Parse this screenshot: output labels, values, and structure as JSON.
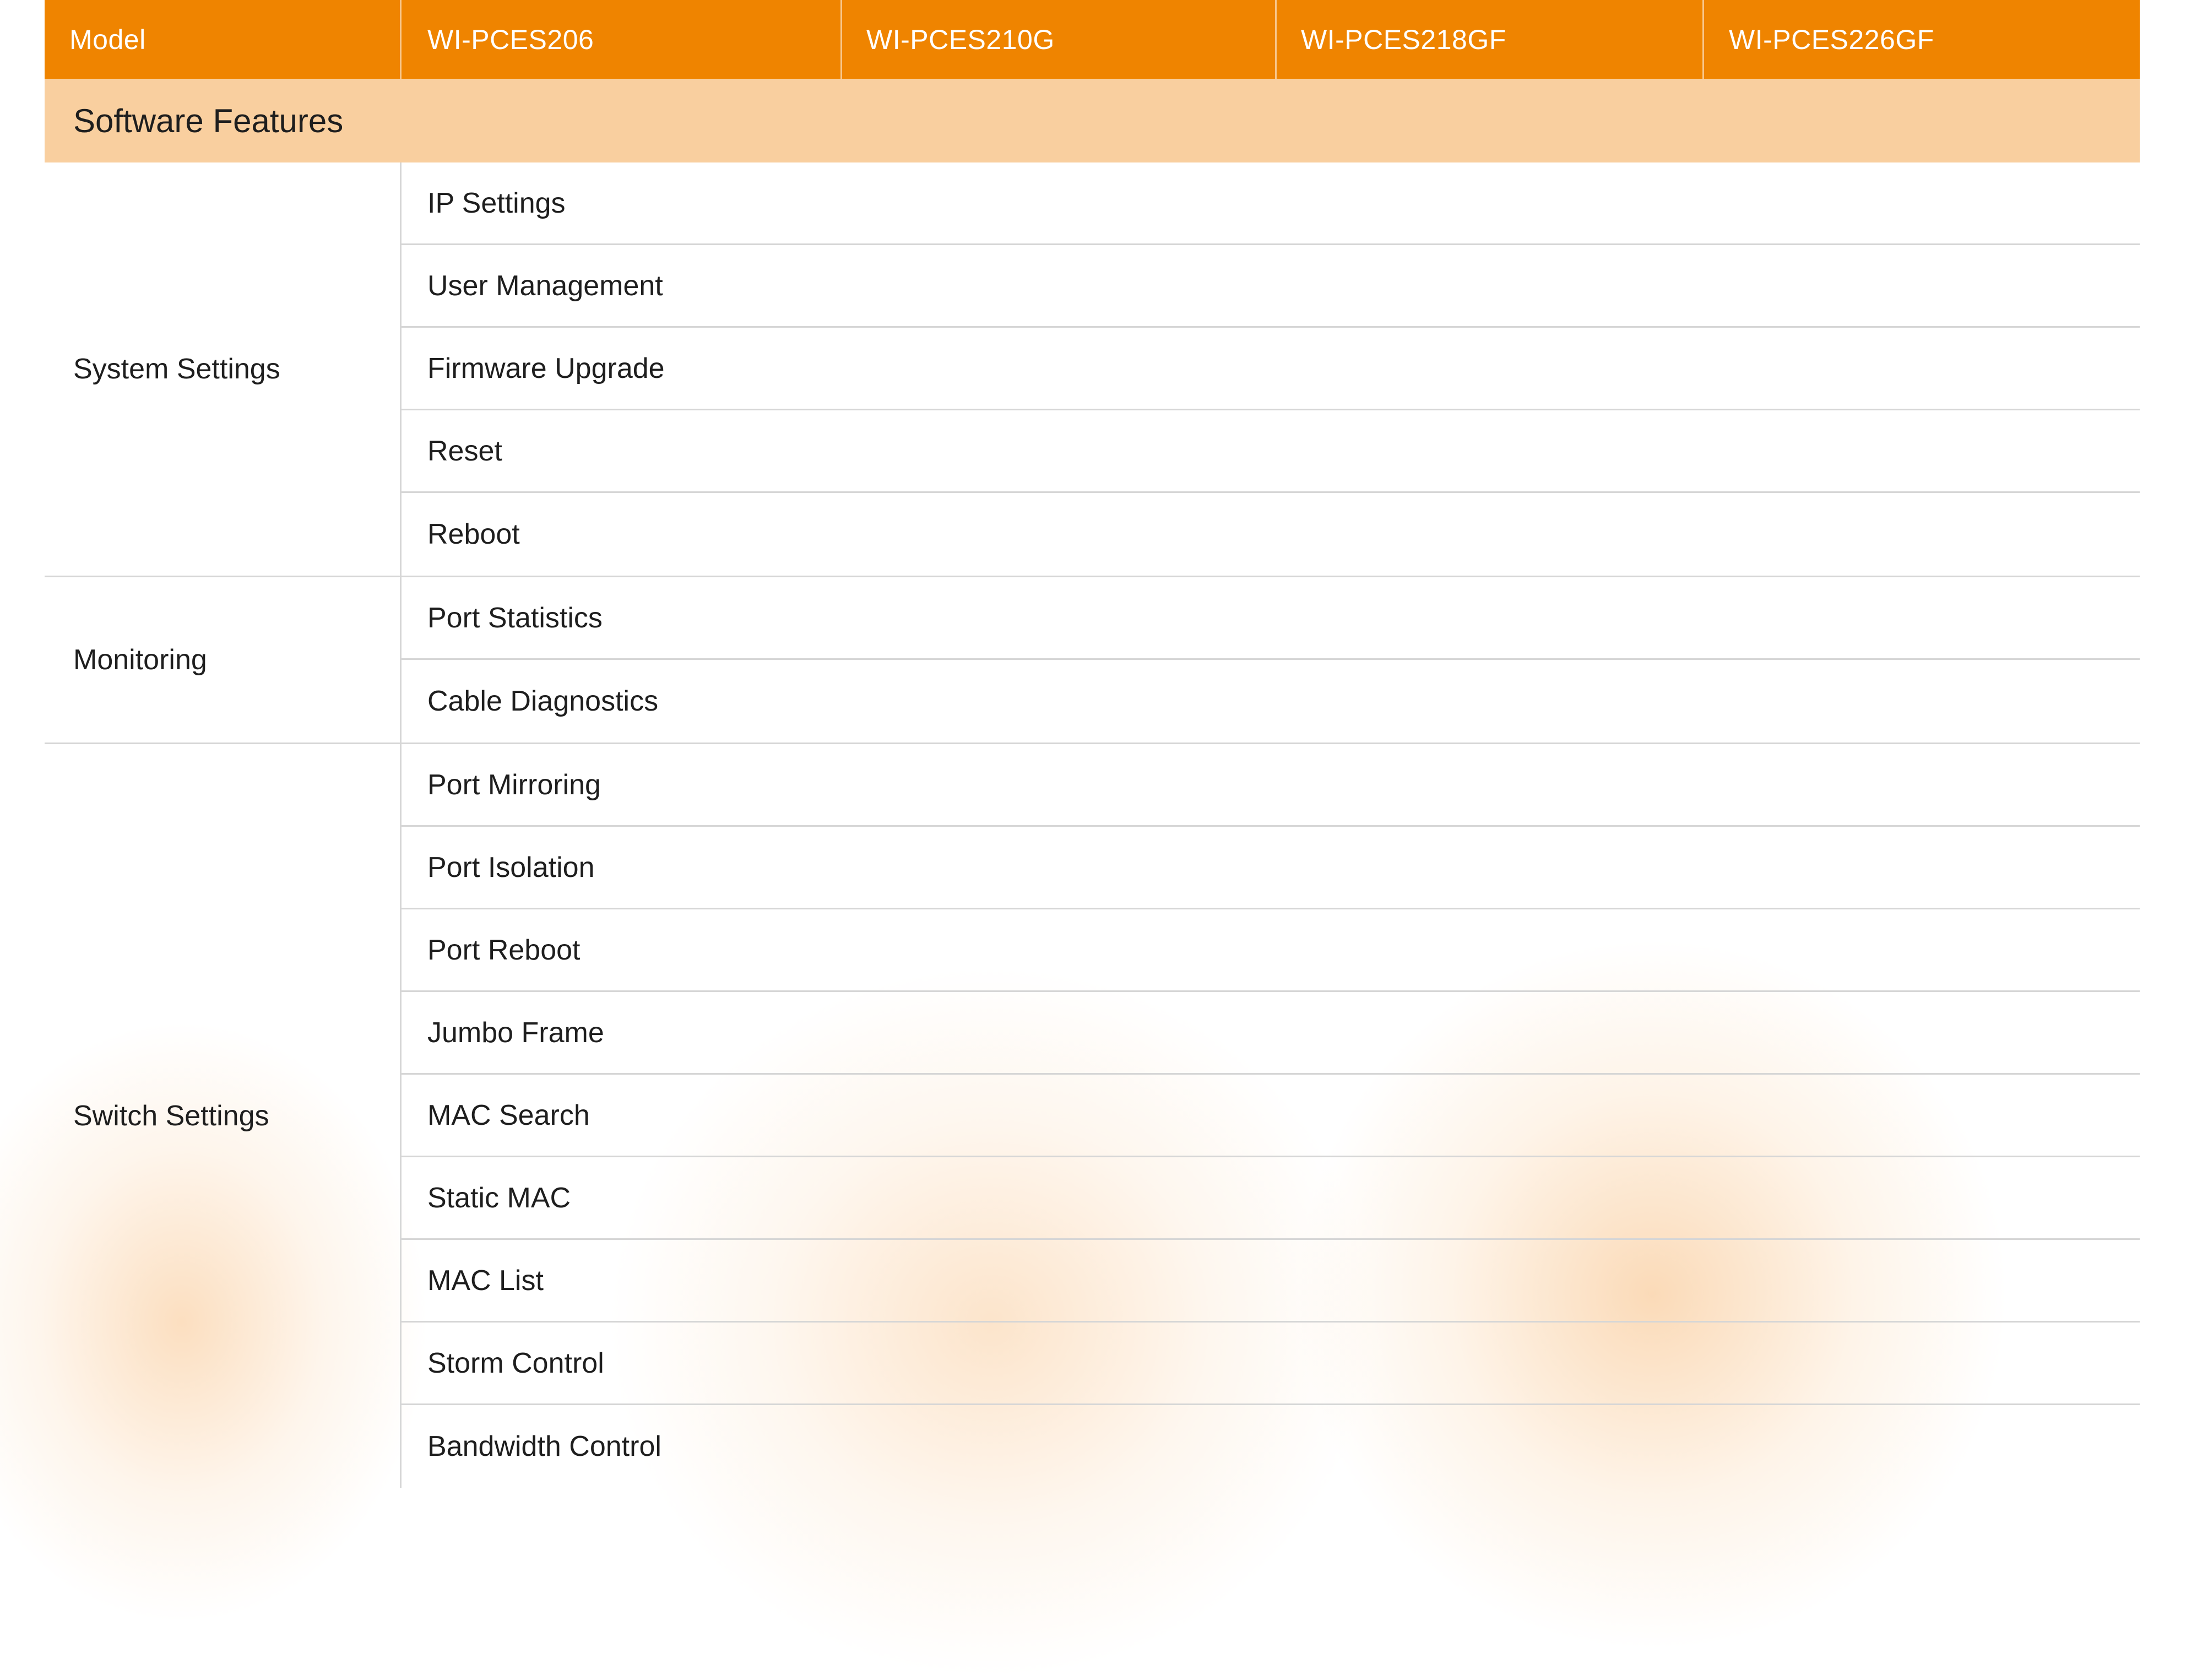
{
  "header": {
    "models": [
      "Model",
      "WI-PCES206",
      "WI-PCES210G",
      "WI-PCES218GF",
      "WI-PCES226GF"
    ]
  },
  "section": {
    "title": "Software Features"
  },
  "groups": [
    {
      "label": "System Settings",
      "features": [
        "IP Settings",
        "User Management",
        "Firmware Upgrade",
        "Reset",
        "Reboot"
      ]
    },
    {
      "label": "Monitoring",
      "features": [
        "Port Statistics",
        "Cable Diagnostics"
      ]
    },
    {
      "label": "Switch Settings",
      "features": [
        "Port Mirroring",
        "Port Isolation",
        "Port Reboot",
        "Jumbo Frame",
        "MAC Search",
        "Static MAC",
        "MAC List",
        "Storm Control",
        "Bandwidth Control"
      ]
    }
  ],
  "colors": {
    "header_bg": "#ef8400",
    "section_bg": "#f9cf9f",
    "divider": "#d6d6d6"
  }
}
